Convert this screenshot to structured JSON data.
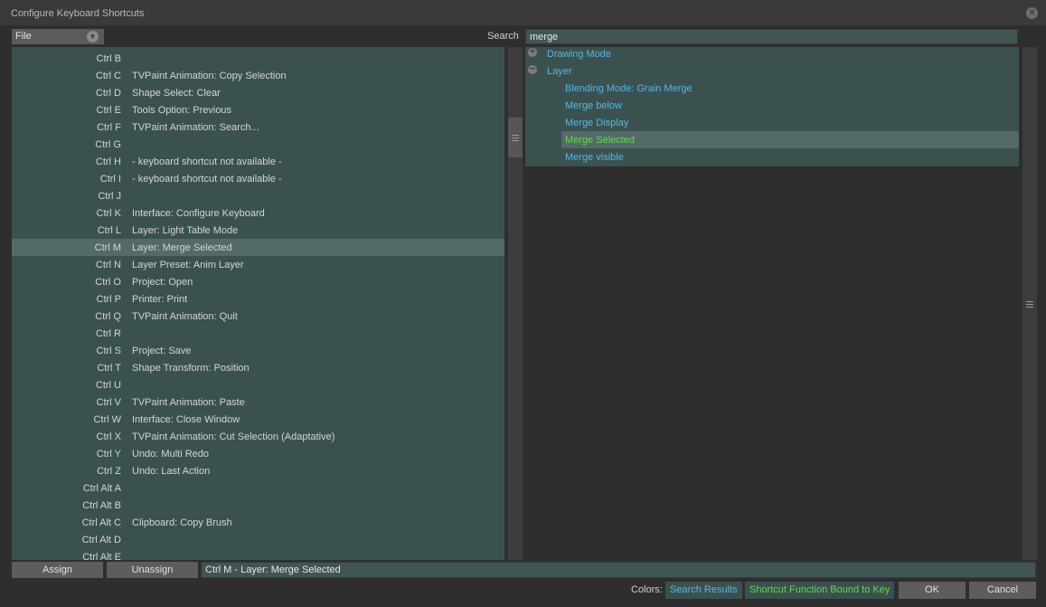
{
  "window": {
    "title": "Configure Keyboard Shortcuts"
  },
  "file_menu": {
    "label": "File"
  },
  "search": {
    "label": "Search",
    "value": "merge"
  },
  "shortcuts": [
    {
      "key": "Ctrl B",
      "function": ""
    },
    {
      "key": "Ctrl C",
      "function": "TVPaint Animation: Copy Selection"
    },
    {
      "key": "Ctrl D",
      "function": "Shape Select: Clear"
    },
    {
      "key": "Ctrl E",
      "function": "Tools Option: Previous"
    },
    {
      "key": "Ctrl F",
      "function": "TVPaint Animation: Search..."
    },
    {
      "key": "Ctrl G",
      "function": ""
    },
    {
      "key": "Ctrl H",
      "function": "- keyboard shortcut not available -"
    },
    {
      "key": "Ctrl I",
      "function": "- keyboard shortcut not available -"
    },
    {
      "key": "Ctrl J",
      "function": ""
    },
    {
      "key": "Ctrl K",
      "function": "Interface: Configure Keyboard"
    },
    {
      "key": "Ctrl L",
      "function": "Layer: Light Table Mode"
    },
    {
      "key": "Ctrl M",
      "function": "Layer: Merge Selected",
      "selected": true
    },
    {
      "key": "Ctrl N",
      "function": "Layer Preset: Anim Layer"
    },
    {
      "key": "Ctrl O",
      "function": "Project: Open"
    },
    {
      "key": "Ctrl P",
      "function": "Printer: Print"
    },
    {
      "key": "Ctrl Q",
      "function": "TVPaint Animation: Quit"
    },
    {
      "key": "Ctrl R",
      "function": ""
    },
    {
      "key": "Ctrl S",
      "function": "Project: Save"
    },
    {
      "key": "Ctrl T",
      "function": "Shape Transform: Position"
    },
    {
      "key": "Ctrl U",
      "function": ""
    },
    {
      "key": "Ctrl V",
      "function": "TVPaint Animation: Paste"
    },
    {
      "key": "Ctrl W",
      "function": "Interface: Close Window"
    },
    {
      "key": "Ctrl X",
      "function": "TVPaint Animation: Cut Selection (Adaptative)"
    },
    {
      "key": "Ctrl Y",
      "function": "Undo: Multi Redo"
    },
    {
      "key": "Ctrl Z",
      "function": "Undo: Last Action"
    },
    {
      "key": "Ctrl Alt A",
      "function": ""
    },
    {
      "key": "Ctrl Alt B",
      "function": ""
    },
    {
      "key": "Ctrl Alt C",
      "function": "Clipboard: Copy Brush"
    },
    {
      "key": "Ctrl Alt D",
      "function": ""
    },
    {
      "key": "Ctrl Alt E",
      "function": ""
    }
  ],
  "search_results": [
    {
      "label": "Drawing Mode",
      "type": "group",
      "expanded": false
    },
    {
      "label": "Layer",
      "type": "group",
      "expanded": true
    },
    {
      "label": "Blending Mode: Grain Merge",
      "type": "leaf"
    },
    {
      "label": "Merge below",
      "type": "leaf"
    },
    {
      "label": "Merge Display",
      "type": "leaf"
    },
    {
      "label": "Merge Selected",
      "type": "leaf",
      "selected": true
    },
    {
      "label": "Merge visible",
      "type": "leaf"
    }
  ],
  "actions": {
    "assign": "Assign",
    "unassign": "Unassign",
    "current_binding": "Ctrl M - Layer: Merge Selected"
  },
  "legend": {
    "label": "Colors:",
    "search_results": "Search Results",
    "bound": "Shortcut Function Bound to Key",
    "search_color": "#56b6e6",
    "bound_color": "#5fdc42"
  },
  "footer": {
    "ok": "OK",
    "cancel": "Cancel"
  }
}
